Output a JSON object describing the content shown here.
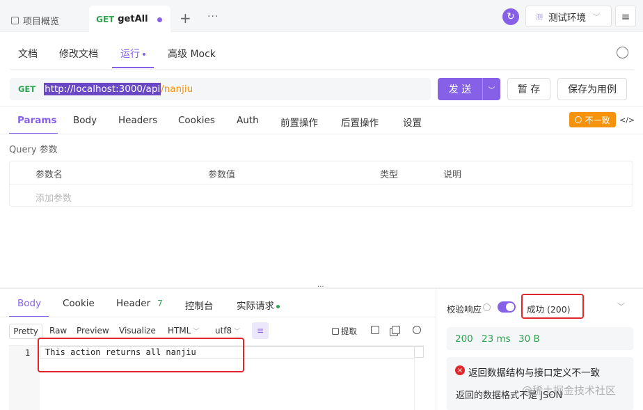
{
  "tabs": {
    "overview": "项目概览",
    "active_method": "GET",
    "active_name": "getAll",
    "add": "+",
    "more": "···"
  },
  "env": {
    "badge": "测",
    "name": "测试环境"
  },
  "subtabs": [
    "文档",
    "修改文档",
    "运行",
    "高级 Mock"
  ],
  "url": {
    "method": "GET",
    "base": "http://localhost:3000/api",
    "path": "/nanjiu"
  },
  "buttons": {
    "send": "发 送",
    "save": "暂 存",
    "save_case": "保存为用例"
  },
  "param_tabs": [
    "Params",
    "Body",
    "Headers",
    "Cookies",
    "Auth",
    "前置操作",
    "后置操作",
    "设置"
  ],
  "inconsistent": "不一致",
  "code_icon": "</>",
  "query": {
    "title": "Query 参数",
    "headers": [
      "参数名",
      "参数值",
      "类型",
      "说明"
    ],
    "add_placeholder": "添加参数"
  },
  "response": {
    "tabs": [
      "Body",
      "Cookie",
      "Header",
      "控制台",
      "实际请求"
    ],
    "header_count": "7",
    "view": [
      "Pretty",
      "Raw",
      "Preview",
      "Visualize"
    ],
    "format": "HTML",
    "encoding": "utf8",
    "extract": "提取",
    "line_no": "1",
    "body": "This action returns all nanjiu"
  },
  "validate": {
    "label": "校验响应",
    "status": "成功 (200)",
    "code": "200",
    "time": "23 ms",
    "size": "30 B",
    "error_title": "返回数据结构与接口定义不一致",
    "error_msg": "返回的数据格式不是 JSON"
  },
  "watermark": "@稀土掘金技术社区"
}
